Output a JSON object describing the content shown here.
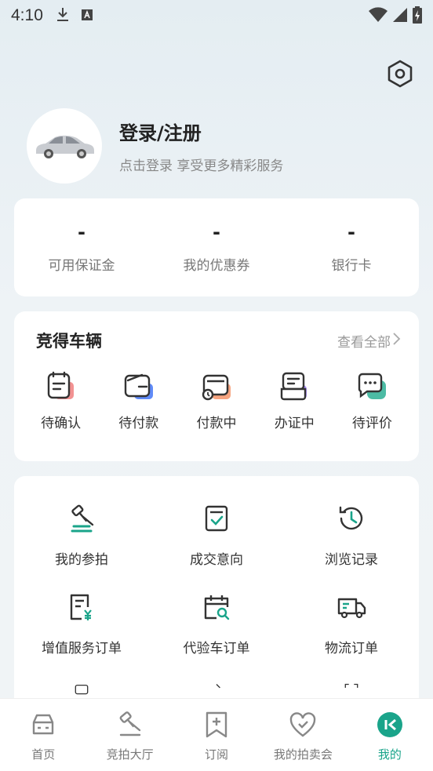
{
  "status": {
    "time": "4:10",
    "left_icons": [
      "download-icon",
      "text-a-icon"
    ],
    "right_icons": [
      "wifi-icon",
      "signal-icon",
      "battery-charging-icon"
    ]
  },
  "header": {
    "settings_icon": "gear-icon"
  },
  "profile": {
    "title": "登录/注册",
    "subtitle": "点击登录 享受更多精彩服务",
    "avatar_icon": "car-icon"
  },
  "stats": [
    {
      "value": "-",
      "label": "可用保证金"
    },
    {
      "value": "-",
      "label": "我的优惠券"
    },
    {
      "value": "-",
      "label": "银行卡"
    }
  ],
  "won": {
    "title": "竞得车辆",
    "view_all": "查看全部",
    "items": [
      {
        "label": "待确认",
        "icon": "confirm-doc-icon",
        "accent": "#f07f7f"
      },
      {
        "label": "待付款",
        "icon": "wallet-icon",
        "accent": "#4f7ef7"
      },
      {
        "label": "付款中",
        "icon": "payment-progress-icon",
        "accent": "#f59a72"
      },
      {
        "label": "办证中",
        "icon": "certificate-icon",
        "accent": "#9b7ef2"
      },
      {
        "label": "待评价",
        "icon": "review-chat-icon",
        "accent": "#39b49a"
      }
    ]
  },
  "menu": {
    "items": [
      {
        "label": "我的参拍",
        "icon": "gavel-icon"
      },
      {
        "label": "成交意向",
        "icon": "checked-doc-icon"
      },
      {
        "label": "浏览记录",
        "icon": "history-icon"
      },
      {
        "label": "增值服务订单",
        "icon": "yuan-doc-icon"
      },
      {
        "label": "代验车订单",
        "icon": "calendar-search-icon"
      },
      {
        "label": "物流订单",
        "icon": "truck-icon"
      }
    ]
  },
  "tabs": [
    {
      "label": "首页",
      "icon": "car-front-icon",
      "active": false
    },
    {
      "label": "竞拍大厅",
      "icon": "gavel-icon",
      "active": false
    },
    {
      "label": "订阅",
      "icon": "bookmark-add-icon",
      "active": false
    },
    {
      "label": "我的拍卖会",
      "icon": "heart-check-icon",
      "active": false
    },
    {
      "label": "我的",
      "icon": "profile-active-icon",
      "active": true
    }
  ],
  "colors": {
    "accent": "#1aa48a",
    "text_primary": "#222222",
    "text_secondary": "#888888"
  }
}
